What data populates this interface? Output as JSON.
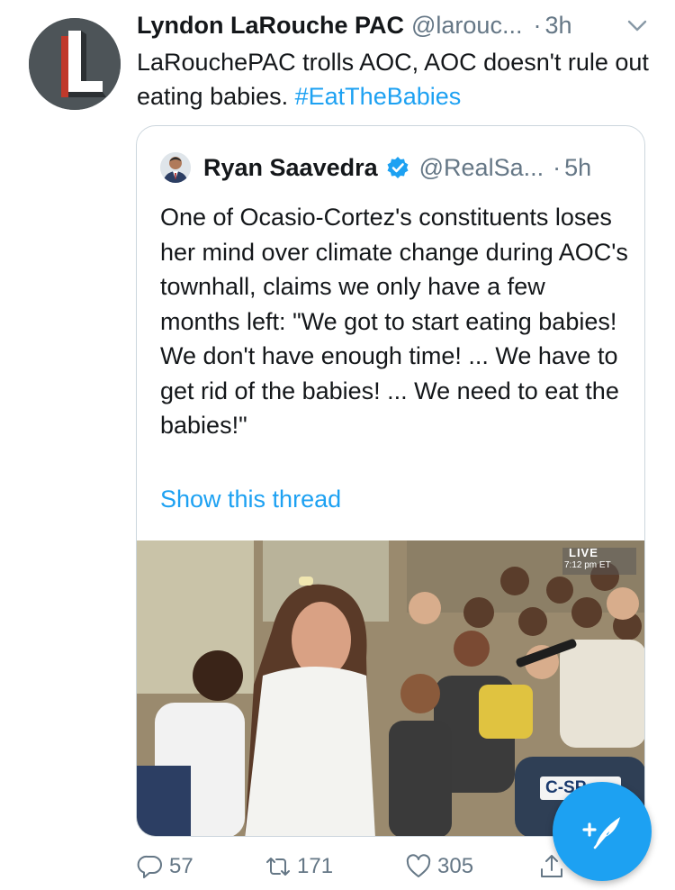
{
  "tweet": {
    "author_name": "Lyndon LaRouche PAC",
    "author_handle": "@larouc...",
    "separator": "·",
    "time": "3h",
    "text_before": "LaRouchePAC trolls AOC, AOC doesn't rule out eating babies. ",
    "hashtag": "#EatTheBabies",
    "avatar_letter": "L",
    "icons": {
      "avatar": "larouche-logo-icon",
      "menu": "chevron-down-icon"
    }
  },
  "quote": {
    "author_name": "Ryan Saavedra",
    "author_handle": "@RealSa...",
    "separator": "·",
    "time": "5h",
    "text": "One of Ocasio-Cortez's constituents loses her mind over climate change during AOC's townhall, claims we only have a few months left: \"We got to start eating babies! We don't have enough time! ...  We have to get rid of the babies! ... We need to eat the babies!\"",
    "show_thread": "Show this thread",
    "media": {
      "live_badge": "LIVE",
      "live_time": "7:12 pm ET",
      "network_logo": "C-SP"
    },
    "icons": {
      "verified": "verified-badge-icon",
      "avatar": "profile-avatar-icon"
    }
  },
  "actions": {
    "replies": "57",
    "retweets": "171",
    "likes": "305",
    "icons": [
      "reply-icon",
      "retweet-icon",
      "heart-icon",
      "share-icon"
    ]
  },
  "compose": {
    "icon": "compose-feather-icon"
  },
  "colors": {
    "accent": "#1da1f2",
    "text": "#14171a",
    "muted": "#657786",
    "border": "#ccd6dd",
    "background": "#ffffff"
  }
}
